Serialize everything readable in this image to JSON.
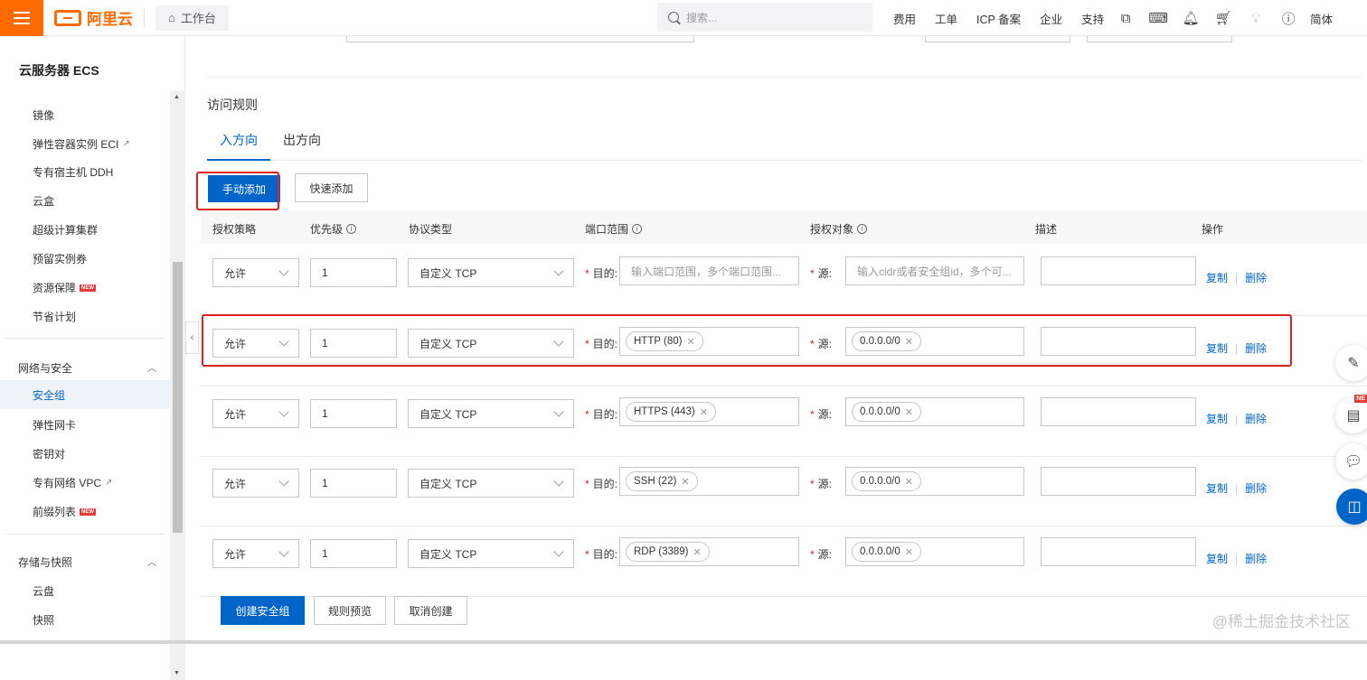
{
  "topbar": {
    "logo_text": "阿里云",
    "workbench_label": "工作台",
    "search_placeholder": "搜索...",
    "nav": [
      "费用",
      "工单",
      "ICP 备案",
      "企业",
      "支持"
    ],
    "lang": "简体",
    "icons": [
      "app-icon",
      "terminal-icon",
      "bell-icon",
      "cart-icon",
      "lightbulb-icon",
      "help-icon"
    ]
  },
  "sidebar": {
    "title": "云服务器 ECS",
    "items_top": [
      "镜像",
      "弹性容器实例 ECI",
      "专有宿主机 DDH",
      "云盒",
      "超级计算集群",
      "预留实例券",
      "资源保障",
      "节省计划"
    ],
    "new_tag": "NEW",
    "group_network": "网络与安全",
    "items_network": [
      "安全组",
      "弹性网卡",
      "密钥对",
      "专有网络 VPC",
      "前缀列表"
    ],
    "group_storage": "存储与快照",
    "items_storage": [
      "云盘",
      "快照"
    ]
  },
  "main": {
    "section_title": "访问规则",
    "tabs": [
      "入方向",
      "出方向"
    ],
    "btn_manual": "手动添加",
    "btn_quick": "快速添加",
    "columns": [
      "授权策略",
      "优先级",
      "协议类型",
      "端口范围",
      "授权对象",
      "描述",
      "操作"
    ],
    "dest_label": "目的:",
    "src_label": "源:",
    "ops_copy": "复制",
    "ops_delete": "删除",
    "rows": [
      {
        "policy": "允许",
        "priority": "1",
        "protocol": "自定义 TCP",
        "port": "",
        "port_placeholder": "输入端口范围，多个端口范围...",
        "source": "",
        "source_placeholder": "输入cidr或者安全组id，多个可..."
      },
      {
        "policy": "允许",
        "priority": "1",
        "protocol": "自定义 TCP",
        "port": "HTTP (80)",
        "source": "0.0.0.0/0"
      },
      {
        "policy": "允许",
        "priority": "1",
        "protocol": "自定义 TCP",
        "port": "HTTPS (443)",
        "source": "0.0.0.0/0"
      },
      {
        "policy": "允许",
        "priority": "1",
        "protocol": "自定义 TCP",
        "port": "SSH (22)",
        "source": "0.0.0.0/0"
      },
      {
        "policy": "允许",
        "priority": "1",
        "protocol": "自定义 TCP",
        "port": "RDP (3389)",
        "source": "0.0.0.0/0"
      }
    ],
    "btn_create": "创建安全组",
    "btn_preview": "规则预览",
    "btn_cancel": "取消创建"
  },
  "float_new": "NE",
  "watermark": "@稀土掘金技术社区",
  "colors": {
    "accent": "#0064c8",
    "brand": "#ff6a00",
    "highlight": "#e02020"
  }
}
